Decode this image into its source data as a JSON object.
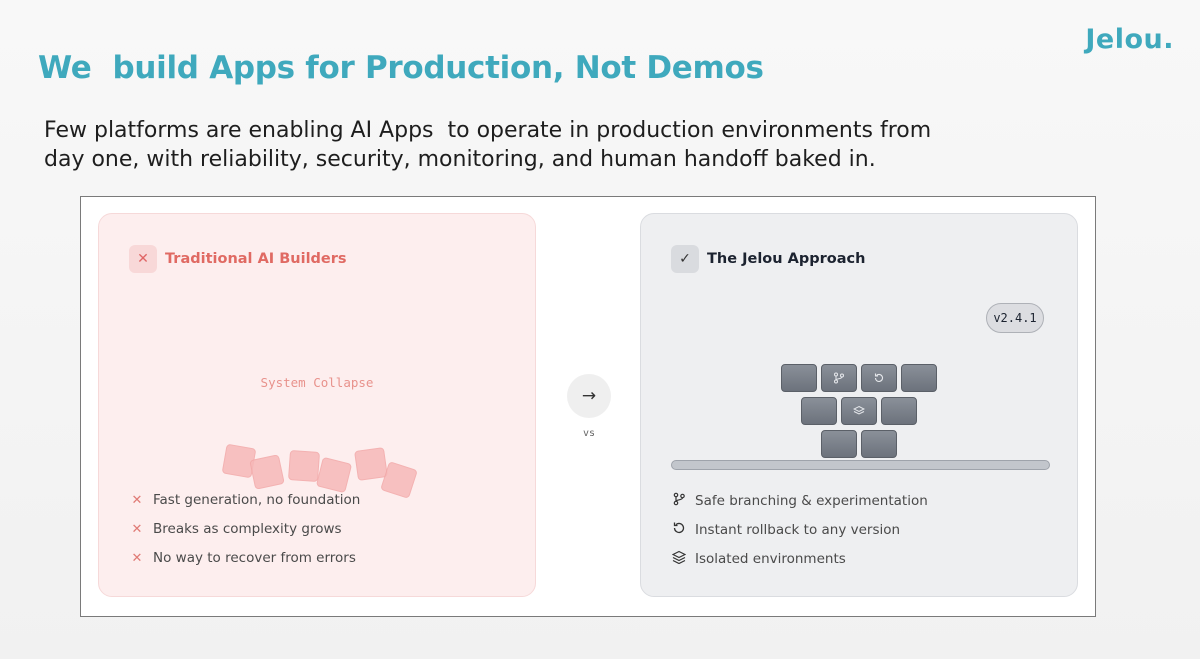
{
  "brand": {
    "logo": "Jelou."
  },
  "title": "We  build Apps for Production, Not Demos",
  "subtitle": "Few platforms are enabling AI Apps  to operate in production environments from\nday one, with reliability, security, monitoring, and human handoff baked in.",
  "left_card": {
    "icon": "x-icon",
    "title": "Traditional AI Builders",
    "visual_label": "System Collapse",
    "features": [
      {
        "icon": "x-icon",
        "text": "Fast generation, no foundation"
      },
      {
        "icon": "x-icon",
        "text": "Breaks as complexity grows"
      },
      {
        "icon": "x-icon",
        "text": "No way to recover from errors"
      }
    ]
  },
  "divider": {
    "icon": "arrow-right-icon",
    "label": "vs"
  },
  "right_card": {
    "icon": "check-icon",
    "title": "The Jelou Approach",
    "version": "v2.4.1",
    "features": [
      {
        "icon": "branch-icon",
        "text": "Safe branching & experimentation"
      },
      {
        "icon": "rollback-icon",
        "text": "Instant rollback to any version"
      },
      {
        "icon": "layers-icon",
        "text": "Isolated environments"
      }
    ]
  },
  "colors": {
    "brand_teal": "#3fa9bd",
    "danger_red": "#e06a63",
    "dark_text": "#1c2330"
  }
}
